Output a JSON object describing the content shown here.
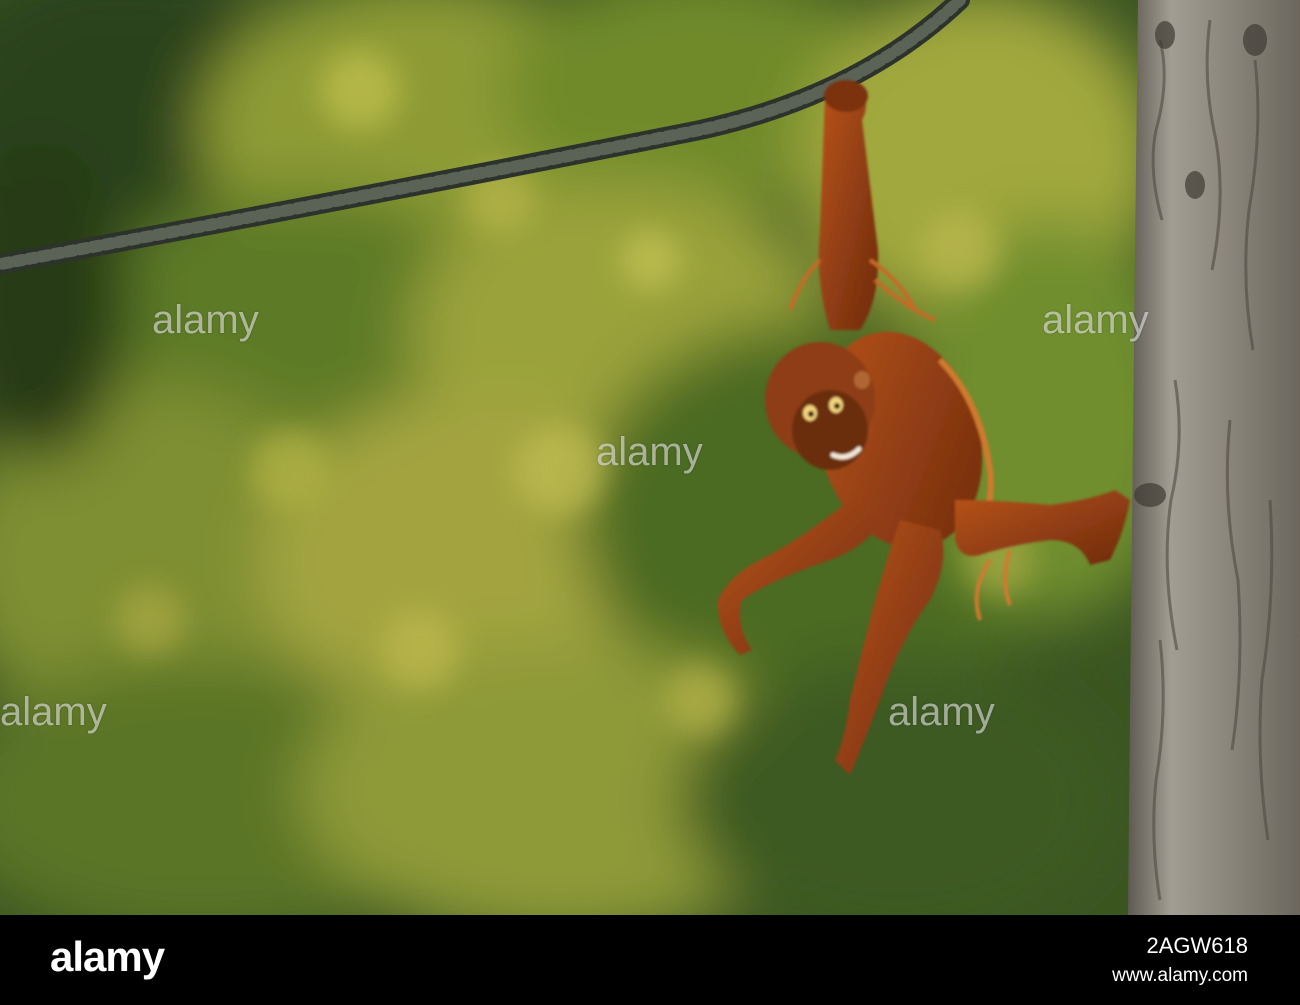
{
  "image": {
    "description_colors": {
      "background_dark_green": "#2f4a1c",
      "background_light_green": "#9aa63a",
      "rope": "#3a4038",
      "fur": "#8a3a12",
      "fur_light": "#c4621f",
      "bark": "#8a857a"
    }
  },
  "watermarks": [
    "alamy",
    "alamy",
    "alamy",
    "alamy",
    "alamy",
    "alamy"
  ],
  "footer": {
    "logo": "alamy",
    "image_id": "2AGW618",
    "url": "www.alamy.com"
  }
}
